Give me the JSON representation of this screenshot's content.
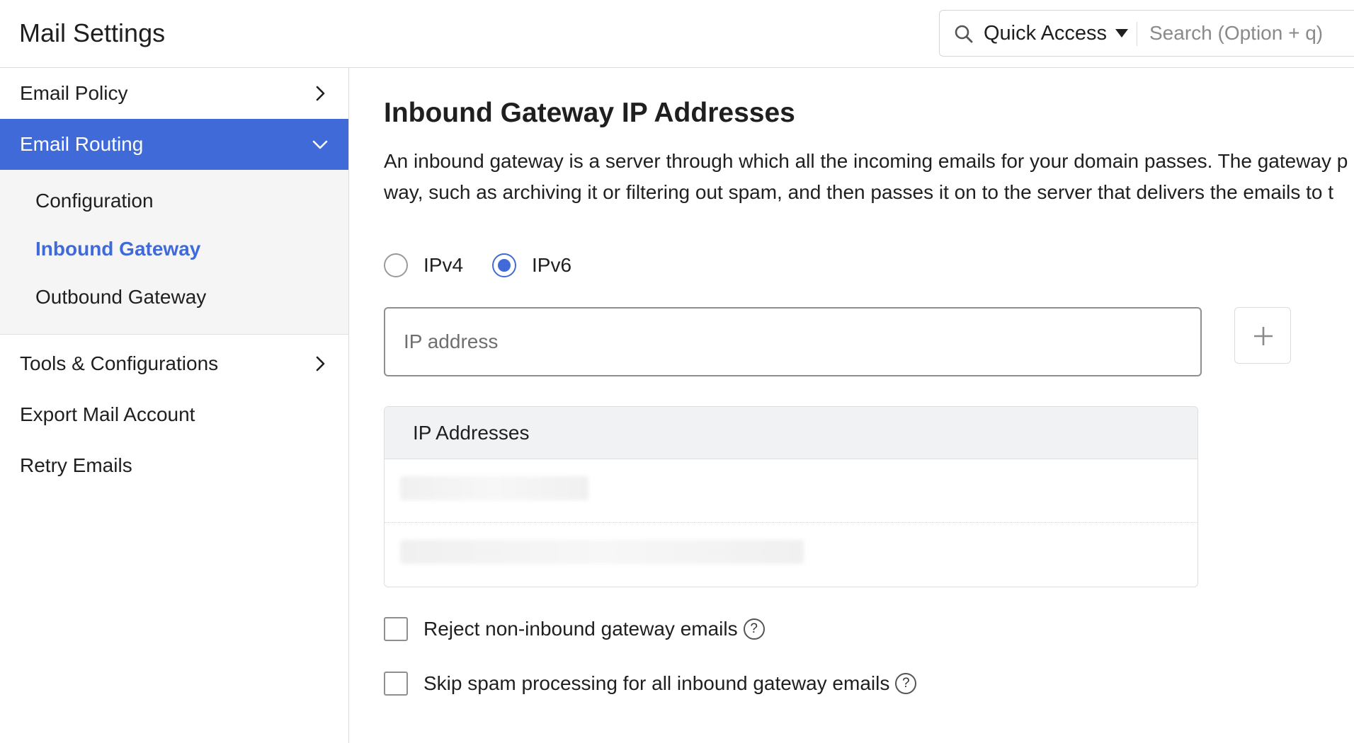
{
  "header": {
    "title": "Mail Settings",
    "quick_access_label": "Quick Access",
    "search_placeholder": "Search (Option + q)"
  },
  "sidebar": {
    "items": [
      {
        "label": "Email Policy",
        "state": "collapsed"
      },
      {
        "label": "Email Routing",
        "state": "expanded",
        "active": true
      },
      {
        "label": "Tools & Configurations",
        "state": "collapsed"
      },
      {
        "label": "Export Mail Account"
      },
      {
        "label": "Retry Emails"
      }
    ],
    "submenu": [
      {
        "label": "Configuration"
      },
      {
        "label": "Inbound Gateway",
        "selected": true
      },
      {
        "label": "Outbound Gateway"
      }
    ]
  },
  "main": {
    "title": "Inbound Gateway IP Addresses",
    "description_line1": "An inbound gateway is a server through which all the incoming emails for your domain passes. The gateway p",
    "description_line2": "way, such as archiving it or filtering out spam, and then passes it on to the server that delivers the emails to t",
    "ip_version_options": [
      {
        "label": "IPv4",
        "checked": false
      },
      {
        "label": "IPv6",
        "checked": true
      }
    ],
    "ip_input_placeholder": "IP address",
    "table_header": "IP Addresses",
    "options": [
      {
        "label": "Reject non-inbound gateway emails",
        "checked": false
      },
      {
        "label": "Skip spam processing for all inbound gateway emails",
        "checked": false
      }
    ]
  },
  "colors": {
    "accent": "#3f6ad8",
    "border": "#dcdcdc",
    "table_header_bg": "#f1f2f4",
    "submenu_bg": "#f5f5f6"
  },
  "icons": {
    "search": "search-icon",
    "dropdown": "caret-down-icon",
    "chevron_right": "chevron-right-icon",
    "chevron_down": "chevron-down-icon",
    "add": "plus-icon",
    "help": "help-icon"
  }
}
